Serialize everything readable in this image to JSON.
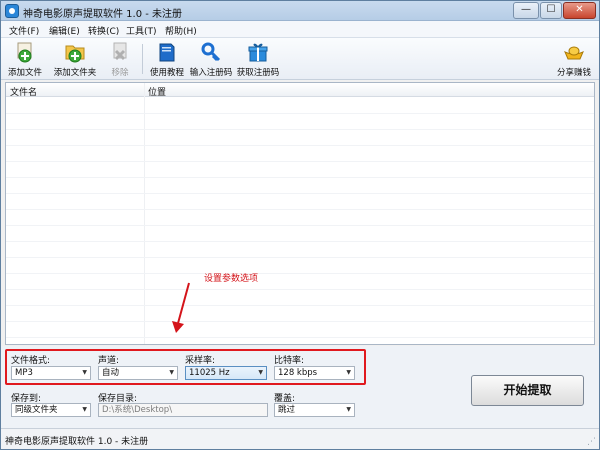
{
  "window": {
    "title": "神奇电影原声提取软件 1.0 - 未注册",
    "minimize": "—",
    "maximize": "☐",
    "close": "✕"
  },
  "menu": [
    "文件(F)",
    "编辑(E)",
    "转换(C)",
    "工具(T)",
    "帮助(H)"
  ],
  "toolbar": {
    "add_file": "添加文件",
    "add_folder": "添加文件夹",
    "remove": "移除",
    "tutorial": "使用教程",
    "enter_code": "输入注册码",
    "get_code": "获取注册码",
    "share": "分享赚钱"
  },
  "list": {
    "col_filename": "文件名",
    "col_location": "位置"
  },
  "annotation": "设置参数选项",
  "settings": {
    "format_label": "文件格式:",
    "format_value": "MP3",
    "channel_label": "声道:",
    "channel_value": "自动",
    "samplerate_label": "采样率:",
    "samplerate_value": "11025 Hz",
    "bitrate_label": "比特率:",
    "bitrate_value": "128 kbps",
    "save_to_label": "保存到:",
    "save_to_value": "同级文件夹",
    "save_dir_label": "保存目录:",
    "save_dir_value": "D:\\系统\\Desktop\\",
    "overwrite_label": "覆盖:",
    "overwrite_value": "跳过",
    "start_button": "开始提取"
  },
  "status": "神奇电影原声提取软件 1.0 - 未注册",
  "colors": {
    "highlight": "#e0191e",
    "titlebar": "#c8daee"
  }
}
